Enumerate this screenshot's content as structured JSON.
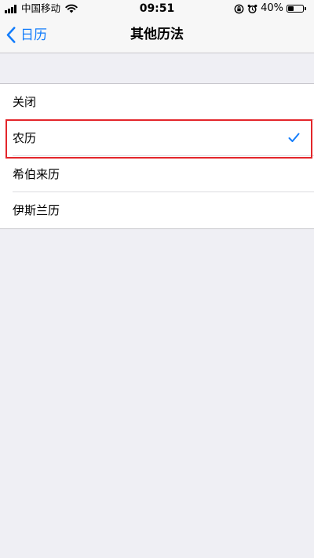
{
  "status_bar": {
    "carrier": "中国移动",
    "time": "09:51",
    "battery_percent_label": "40%",
    "battery_level": 0.4,
    "icons": [
      "signal-icon",
      "wifi-icon",
      "orientation-lock-icon",
      "alarm-icon",
      "battery-icon"
    ]
  },
  "nav": {
    "back_label": "日历",
    "title": "其他历法"
  },
  "options": [
    {
      "label": "关闭",
      "selected": false
    },
    {
      "label": "农历",
      "selected": true
    },
    {
      "label": "希伯来历",
      "selected": false
    },
    {
      "label": "伊斯兰历",
      "selected": false
    }
  ],
  "colors": {
    "accent": "#157efb",
    "background": "#efeff4",
    "highlight": "#e3262b"
  }
}
